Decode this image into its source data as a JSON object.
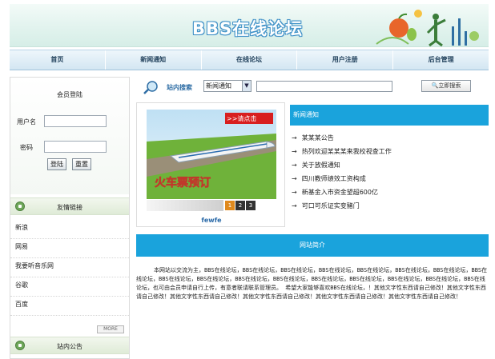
{
  "header": {
    "site_title": "BBS在线论坛"
  },
  "nav": {
    "items": [
      "首页",
      "新闻通知",
      "在线论坛",
      "用户注册",
      "后台管理"
    ]
  },
  "login": {
    "title": "会员登陆",
    "username_label": "用户名",
    "password_label": "密码",
    "login_button": "登陆",
    "reset_button": "重置"
  },
  "links": {
    "title": "友情链接",
    "items": [
      "新浪",
      "网易",
      "我要听音乐网",
      "谷歌",
      "百度"
    ],
    "more_label": "MORE"
  },
  "notice": {
    "title": "站内公告"
  },
  "search": {
    "label": "站内搜索",
    "category": "新闻通知",
    "button": "立即搜索"
  },
  "slideshow": {
    "banner_text": "火车票预订",
    "tag_text": ">>请点击",
    "pages": [
      "1",
      "2",
      "3"
    ],
    "active_page": "1",
    "caption": "fewfe"
  },
  "news": {
    "title": "新闻通知",
    "items": [
      "某某某公告",
      "热列欢迎某某某来我校视查工作",
      "关于放假通知",
      "四川教师绩效工资构成",
      "新基金入市资金望超600亿",
      "可口可乐证实变豬门"
    ]
  },
  "intro": {
    "title": "网站简介",
    "text": "本网站以交流为主，BBS在线论坛，BBS在线论坛，BBS在线论坛，BBS在线论坛，BBS在线论坛，BBS在线论坛，BBS在线论坛，BBS在线论坛，BBS在线论坛，BBS在线论坛，BBS在线论坛，BBS在线论坛，BBS在线论坛，BBS在线论坛，BBS在线论坛，BBS在线论坛，BBS在线论坛，也可由会员申请自行上传，有意者联请联系管理员。   希望大家能够喜欢BBS在线论坛，！其他文字性东西请自己修改！其他文字性东西请自己修改！其他文字性东西请自己修改！其他文字性东西请自己修改！其他文字性东西请自己修改！其他文字性东西请自己修改！"
  },
  "colors": {
    "accent": "#1aa3dc",
    "link": "#2b6aa8",
    "pager_active": "#e08a1e"
  }
}
